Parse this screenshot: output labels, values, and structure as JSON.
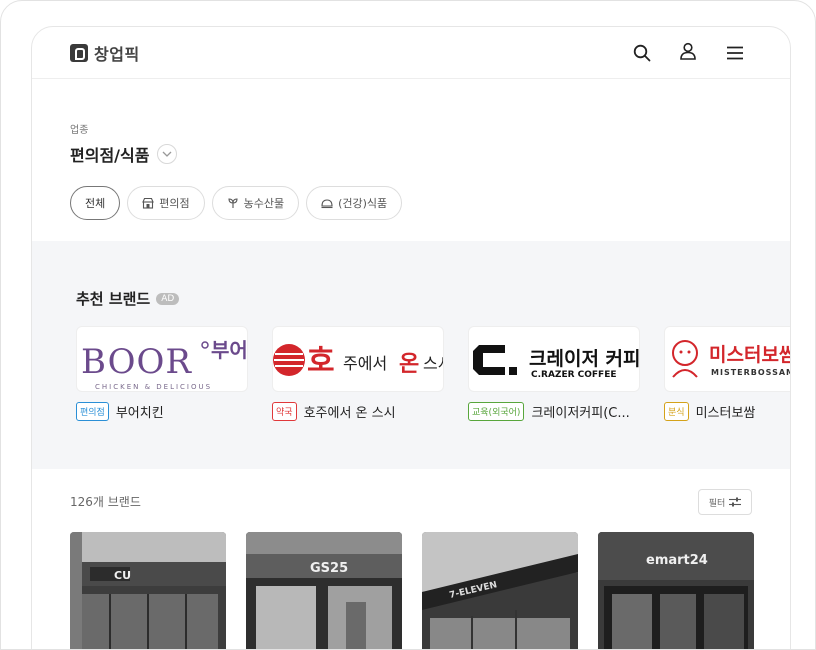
{
  "app": {
    "logo_text": "창업픽"
  },
  "header_icons": [
    "search-icon",
    "user-icon",
    "menu-icon"
  ],
  "sector": {
    "label": "업종",
    "value": "편의점/식품"
  },
  "chips": [
    {
      "label": "전체",
      "icon": ""
    },
    {
      "label": "편의점",
      "icon": "store-icon"
    },
    {
      "label": "농수산물",
      "icon": "sprout-icon"
    },
    {
      "label": "(건강)식품",
      "icon": "food-icon"
    }
  ],
  "recommended": {
    "title": "추천 브랜드",
    "ad": "AD",
    "brands": [
      {
        "tag": "편의점",
        "tag_color": "#2a8fd6",
        "name": "부어치킨",
        "logo": {
          "main": "BOOR",
          "side": "부어",
          "sub": "CHICKEN & DELICIOUS",
          "color": "#6b4a8c"
        }
      },
      {
        "tag": "약국",
        "tag_color": "#e0383a",
        "name": "호주에서 온 스시",
        "logo": {
          "main": "호",
          "side": "주에서",
          "accent": "온",
          "tail": "스시",
          "color": "#d3262b"
        }
      },
      {
        "tag": "교육(외국어)",
        "tag_color": "#58a63c",
        "name": "크레이저커피(C...",
        "logo": {
          "main": "C.",
          "side": "크레이저 커피",
          "sub": "C.RAZER COFFEE",
          "color": "#111111"
        }
      },
      {
        "tag": "분식",
        "tag_color": "#d4a21a",
        "name": "미스터보쌈",
        "logo": {
          "main": "미스터보쌈",
          "sub": "MISTERBOSSAM",
          "color": "#d3262b"
        }
      }
    ]
  },
  "list": {
    "count": "126개 브랜드",
    "filter_label": "필터",
    "photos": [
      {
        "sign": "CU"
      },
      {
        "sign": "GS25"
      },
      {
        "sign": "7-ELEVEN"
      },
      {
        "sign": "emart24"
      }
    ]
  }
}
